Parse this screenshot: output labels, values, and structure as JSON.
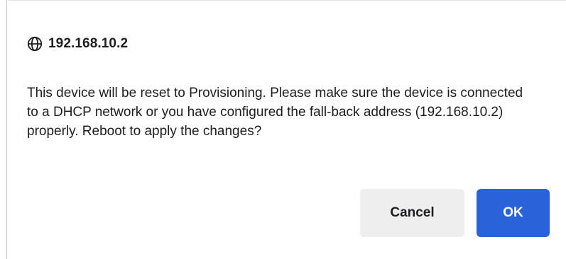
{
  "dialog": {
    "title_icon": "globe-icon",
    "title": "192.168.10.2",
    "message": "This device will be reset to Provisioning. Please make sure the device is connected to a DHCP network or you have configured the fall-back address (192.168.10.2) properly. Reboot to apply the changes?",
    "buttons": {
      "cancel_label": "Cancel",
      "ok_label": "OK"
    },
    "colors": {
      "primary": "#2a62d9",
      "secondary_button": "#eeeeef",
      "text": "#1d1d1f"
    }
  }
}
